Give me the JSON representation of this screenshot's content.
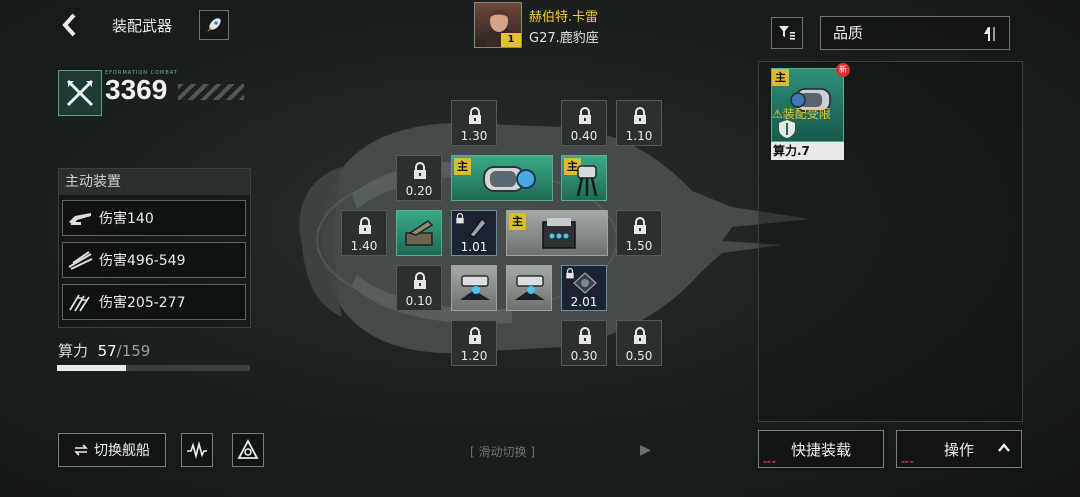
{
  "header": {
    "title": "装配武器",
    "captain_name": "赫伯特.卡雷",
    "captain_level": "1",
    "ship_name": "G27.鹿豹座"
  },
  "left": {
    "power": "3369",
    "power_tag": "EFORMATION COMBAT",
    "active_header": "主动装置",
    "stats": [
      {
        "icon": "cannon-icon",
        "text": "伤害140"
      },
      {
        "icon": "missile-icon",
        "text": "伤害496-549"
      },
      {
        "icon": "drone-icon",
        "text": "伤害205-277"
      }
    ],
    "capacity_label": "算力",
    "capacity_used": "57",
    "capacity_total": "/159",
    "capacity_fraction": 0.36,
    "switch_ship": "切换舰船"
  },
  "slots": {
    "locked_values": [
      "1.30",
      "0.40",
      "1.10",
      "0.20",
      "1.40",
      "1.50",
      "0.10",
      "1.20",
      "0.30",
      "0.50"
    ],
    "equipped": {
      "main_badge": "主",
      "slot_a_value": "1.01",
      "slot_b_value": "2.01"
    }
  },
  "swipe_hint": "滑动切换",
  "right": {
    "sort_label": "品质",
    "inventory": [
      {
        "badge": "主",
        "new_badge": "新",
        "warning": "装配受限",
        "power": "算力.7"
      }
    ],
    "quick_equip": "快捷装载",
    "operate": "操作"
  },
  "colors": {
    "accent_green": "#3aa98a",
    "badge_yellow": "#d8bc31",
    "captain_gold": "#f0c93a"
  }
}
